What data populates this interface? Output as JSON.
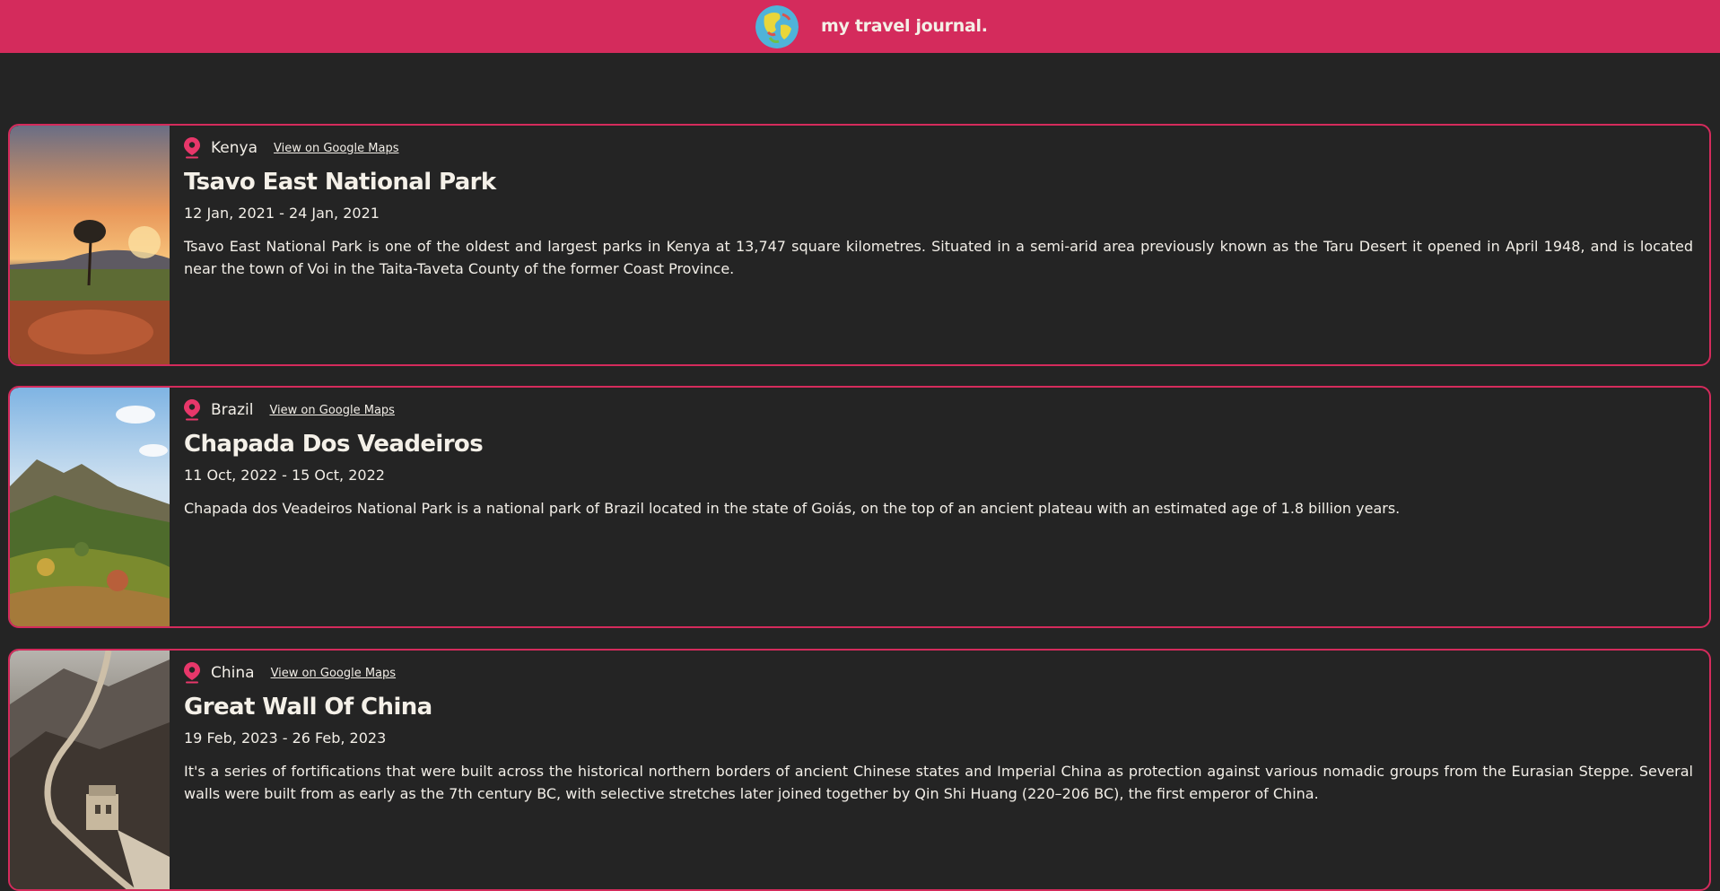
{
  "header": {
    "title": "my travel journal.",
    "logo_icon": "globe-icon",
    "brand_color": "#D42B5C"
  },
  "entries": [
    {
      "country": "Kenya",
      "maps_link": "View on Google Maps",
      "title": "Tsavo East National Park",
      "dates": "12 Jan, 2021 - 24 Jan, 2021",
      "description": "Tsavo East National Park is one of the oldest and largest parks in Kenya at 13,747 square kilometres. Situated in a semi-arid area previously known as the Taru Desert it opened in April 1948, and is located near the town of Voi in the Taita-Taveta County of the former Coast Province."
    },
    {
      "country": "Brazil",
      "maps_link": "View on Google Maps",
      "title": "Chapada Dos Veadeiros",
      "dates": "11 Oct, 2022 - 15 Oct, 2022",
      "description": "Chapada dos Veadeiros National Park is a national park of Brazil located in the state of Goiás, on the top of an ancient plateau with an estimated age of 1.8 billion years."
    },
    {
      "country": "China",
      "maps_link": "View on Google Maps",
      "title": "Great Wall Of China",
      "dates": "19 Feb, 2023 - 26 Feb, 2023",
      "description": "It's a series of fortifications that were built across the historical northern borders of ancient Chinese states and Imperial China as protection against various nomadic groups from the Eurasian Steppe. Several walls were built from as early as the 7th century BC, with selective stretches later joined together by Qin Shi Huang (220–206 BC), the first emperor of China."
    }
  ]
}
